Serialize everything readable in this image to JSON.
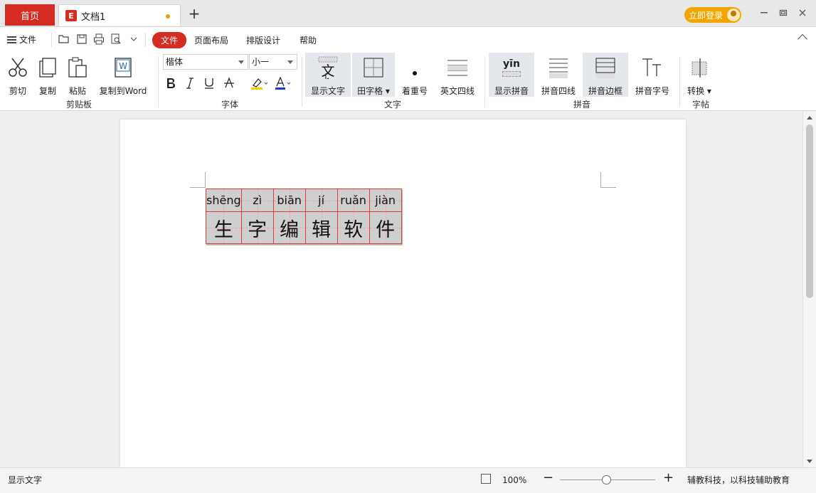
{
  "titlebar": {
    "home_tab": "首页",
    "doc_tab_icon": "E",
    "doc_tab_title": "文档1",
    "add_tab": "+",
    "login_label": "立即登录"
  },
  "menubar": {
    "file_menu": "文件",
    "tabs": [
      "文件",
      "页面布局",
      "排版设计",
      "帮助"
    ],
    "active_tab": "文件"
  },
  "ribbon": {
    "clipboard": {
      "cut": "剪切",
      "copy": "复制",
      "paste": "粘贴",
      "copy_to_word": "复制到Word",
      "group_label": "剪贴板"
    },
    "font": {
      "font_name": "楷体",
      "font_size": "小一",
      "group_label": "字体"
    },
    "text": {
      "show_text": "显示文字",
      "tian_grid": "田字格",
      "emphasis_mark": "着重号",
      "four_line": "英文四线",
      "group_label": "文字"
    },
    "pinyin": {
      "show_pinyin": "显示拼音",
      "pinyin_four_line": "拼音四线",
      "pinyin_border": "拼音边框",
      "pinyin_font_size": "拼音字号",
      "group_label": "拼音",
      "yin_glyph": "yīn"
    },
    "sticker": {
      "convert": "转换",
      "group_label": "字帖"
    }
  },
  "document": {
    "pinyin": [
      "shēng",
      "zì",
      "biān",
      "jí",
      "ruǎn",
      "jiàn"
    ],
    "hanzi": [
      "生",
      "字",
      "编",
      "辑",
      "软",
      "件"
    ]
  },
  "statusbar": {
    "status_text": "显示文字",
    "zoom": "100%",
    "slogan": "辅教科技，以科技辅助教育"
  },
  "colors": {
    "accent_red": "#d42b22",
    "login_orange": "#f0a500",
    "grid_red": "#e03a3a"
  }
}
